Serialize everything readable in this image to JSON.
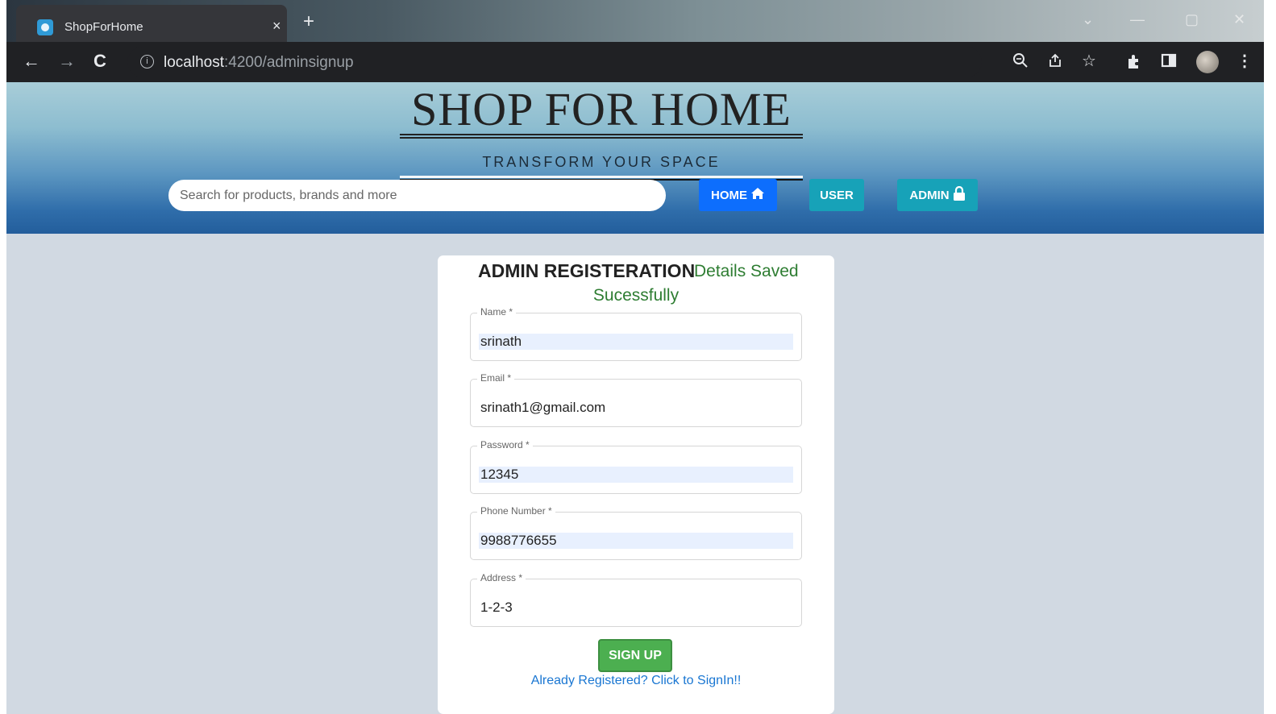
{
  "browser": {
    "tab_title": "ShopForHome",
    "tab_close": "×",
    "new_tab": "+",
    "url_host": "localhost",
    "url_path": ":4200/adminsignup",
    "icons": [
      "back-icon",
      "forward-icon",
      "reload-icon",
      "info-icon",
      "zoom-icon",
      "share-icon",
      "star-icon",
      "extensions-icon",
      "sidebar-icon",
      "profile-avatar",
      "menu-icon"
    ]
  },
  "header": {
    "brand": "SHOP FOR HOME",
    "tagline": "TRANSFORM YOUR SPACE",
    "search_placeholder": "Search for products, brands and more",
    "nav": {
      "home": "HOME",
      "user": "USER",
      "admin": "ADMIN"
    }
  },
  "form": {
    "title": "ADMIN REGISTERATION",
    "message_line1": "Details Saved",
    "message_line2": "Sucessfully",
    "fields": [
      {
        "label": "Name *",
        "value": "srinath"
      },
      {
        "label": "Email *",
        "value": "srinath1@gmail.com"
      },
      {
        "label": "Password *",
        "value": "12345"
      },
      {
        "label": "Phone Number *",
        "value": "9988776655"
      },
      {
        "label": "Address *",
        "value": "1-2-3"
      }
    ],
    "submit_label": "SIGN UP",
    "signin_link": "Already Registered? Click to SignIn!!"
  },
  "colors": {
    "primary_button": "#0d6efd",
    "info_button": "#17a2b8",
    "success_text": "#2e7d32",
    "signup_button": "#4caf50",
    "link": "#1976d2",
    "page_background": "#d1d9e2"
  }
}
